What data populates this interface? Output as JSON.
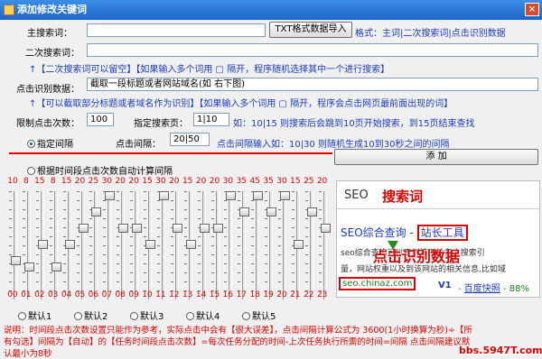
{
  "window": {
    "title": "添加修改关键词",
    "close": "×"
  },
  "form": {
    "main_kw_label": "主搜索词：",
    "main_kw_value": "",
    "txt_import_button": "TXT格式数据导入",
    "format_hint": "格式：主词|二次搜索词|点击识别数据",
    "second_kw_label": "二次搜索词：",
    "second_kw_value": "",
    "second_kw_hint": "↑【二次搜索词可以留空】【如果输入多个词用  ▢  隔开，程序随机选择其中一个进行搜索】",
    "click_id_label": "点击识别数据：",
    "click_id_value": "截取一段标题或者网站域名(如 右下图)",
    "click_id_hint": "↑【可以截取部分标题或者域名作为识别】【如果输入多个词用  ▢  隔开，程序会点击网页最前面出现的词】",
    "limit_label": "限制点击次数：",
    "limit_value": "100",
    "page_label": "指定搜索页：",
    "page_value": "1|10",
    "page_hint": "如：10|15 则搜索后会跳到10页开始搜索，到15页结束查找",
    "interval_radio": "指定间隔",
    "interval_label": "点击间隔：",
    "interval_value": "20|50",
    "interval_hint": "点击间隔输入如：10|30 则随机生成10到30秒之间的间隔",
    "add_button": "添   加",
    "auto_radio": "根据时间段点击次数自动计算间隔"
  },
  "sliders": {
    "top_values": [
      "10",
      "8",
      "15",
      "8",
      "15",
      "20",
      "25",
      "30",
      "20",
      "20",
      "15",
      "30",
      "20",
      "15",
      "20",
      "20",
      "30",
      "35",
      "45",
      "35",
      "30",
      "15",
      "25",
      "20"
    ],
    "bottom_hours": [
      "00",
      "01",
      "02",
      "03",
      "04",
      "05",
      "06",
      "07",
      "08",
      "09",
      "10",
      "11",
      "12",
      "13",
      "14",
      "15",
      "16",
      "17",
      "18",
      "19",
      "20",
      "21",
      "22",
      "23"
    ],
    "levels": [
      0.33,
      0.27,
      0.5,
      0.27,
      0.5,
      0.67,
      0.83,
      1.0,
      0.67,
      0.67,
      0.5,
      1.0,
      0.67,
      0.5,
      0.67,
      0.67,
      1.0,
      0.83,
      1.0,
      0.83,
      1.0,
      0.5,
      0.83,
      0.67
    ]
  },
  "presets": {
    "items": [
      "默认1",
      "默认2",
      "默认3",
      "默认4",
      "默认5"
    ]
  },
  "preview": {
    "seo": "SEO",
    "search_word": "搜索词",
    "result_title": "SEO综合查询 - ",
    "result_site": "站长工具",
    "snippet1": "seo综合查询可以查到该网站各大搜索引",
    "snippet2": "量，网站权重以及到该网站的相关信息,比如域",
    "overlay": "点击识别数据",
    "url": "seo.chinaz.com",
    "v1": "V1",
    "snap": "百度快照",
    "pct": "88%"
  },
  "note": {
    "line1": "说明：时间段点击次数设置只能作为参考，实际点击中会有【很大误差】，点击间隔计算公式为 3600(1小时换算为秒)÷【所",
    "line2": "有勾选】间隔为【自动】的【任务时间段点击次数】=每次任务分配的时间-上次任务执行所需的时间=间隔 点击间隔建议默",
    "line3": "认最小为8秒",
    "watermark": "bbs.5947T.com"
  }
}
